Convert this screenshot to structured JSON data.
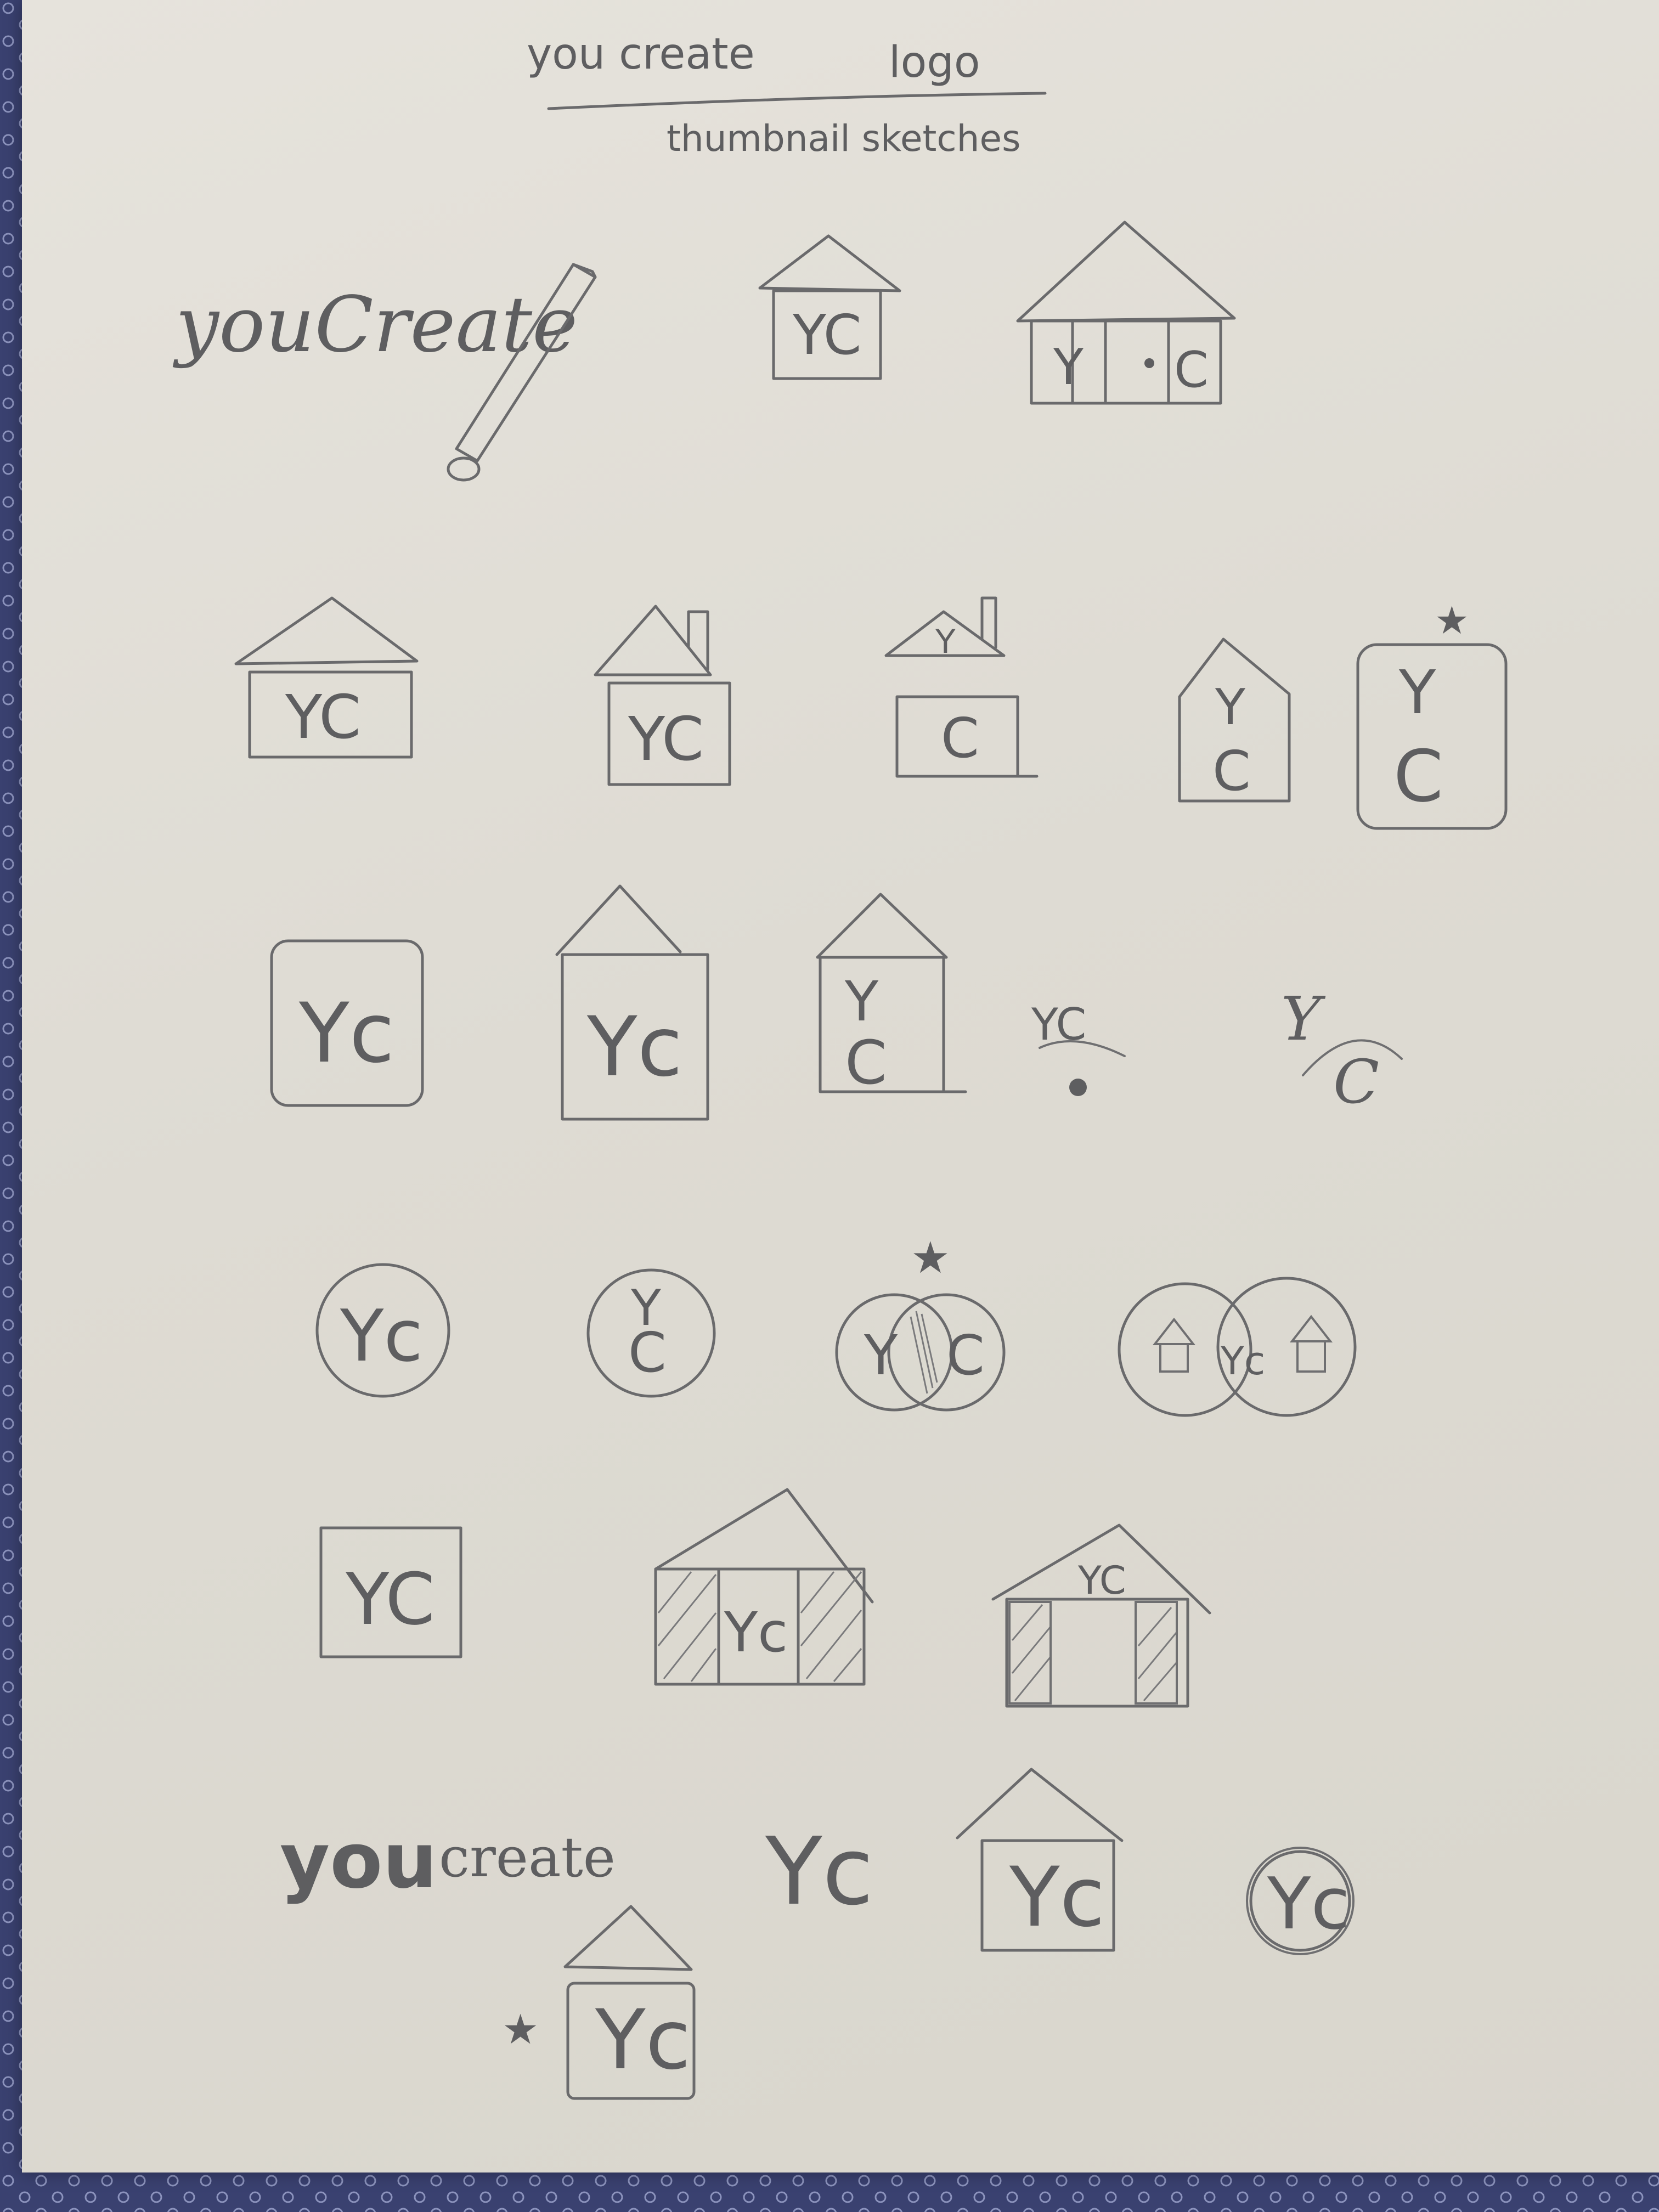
{
  "page": {
    "title": "you create",
    "title_right": "logo",
    "subtitle": "thumbnail sketches"
  },
  "sketches": {
    "wordmark_script": "youCreate",
    "wordmark_bold": "you",
    "wordmark_light": "create",
    "monogram_yc": "YC",
    "monogram_y": "Y",
    "monogram_c": "C",
    "monogram_combined": "Yc"
  },
  "colors": {
    "paper": "#dedbd3",
    "graphite": "#5e5e60",
    "tablecloth": "#3a4170"
  }
}
